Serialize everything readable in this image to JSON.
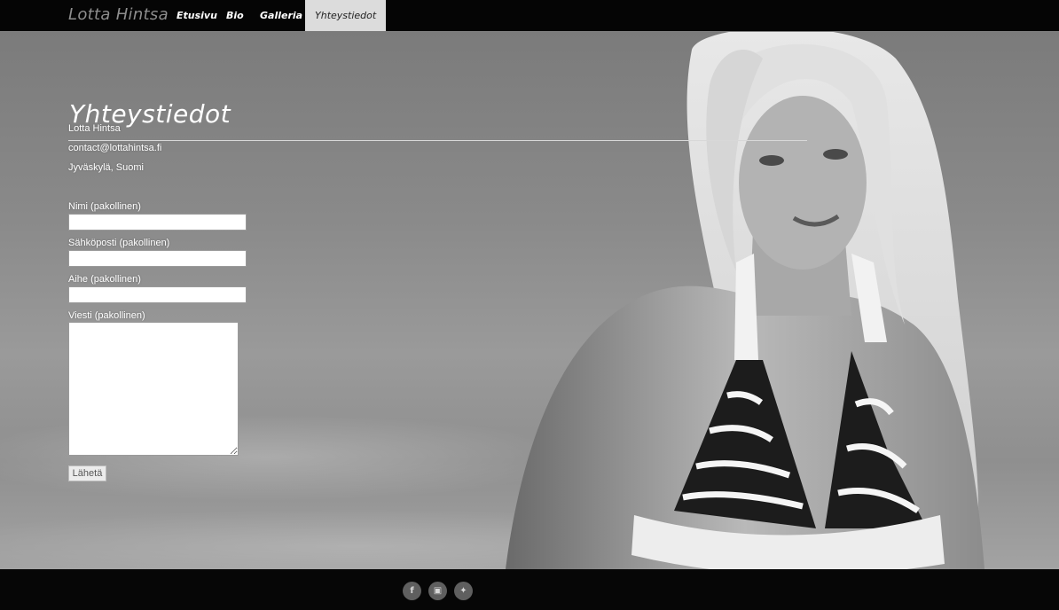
{
  "nav": {
    "brand": "Lotta Hintsa",
    "items": [
      {
        "label": "Etusivu"
      },
      {
        "label": "Bio"
      },
      {
        "label": "Galleria"
      },
      {
        "label": "Yhteystiedot",
        "active": true
      }
    ]
  },
  "page": {
    "title": "Yhteystiedot",
    "contact": {
      "name": "Lotta Hintsa",
      "email": "contact@lottahintsa.fi",
      "location": "Jyväskylä, Suomi"
    }
  },
  "form": {
    "name_label": "Nimi (pakollinen)",
    "email_label": "Sähköposti (pakollinen)",
    "subject_label": "Aihe (pakollinen)",
    "message_label": "Viesti (pakollinen)",
    "submit_label": "Lähetä",
    "name_value": "",
    "email_value": "",
    "subject_value": "",
    "message_value": ""
  },
  "footer": {
    "social": [
      {
        "icon": "facebook-icon",
        "glyph": "f"
      },
      {
        "icon": "instagram-icon",
        "glyph": "▣"
      },
      {
        "icon": "twitter-icon",
        "glyph": "✦"
      }
    ]
  },
  "colors": {
    "navbar_bg": "#050505",
    "active_tab_bg": "#dcdcdc",
    "footer_bg": "#060606",
    "social_icon_bg": "#5f5f5f"
  }
}
